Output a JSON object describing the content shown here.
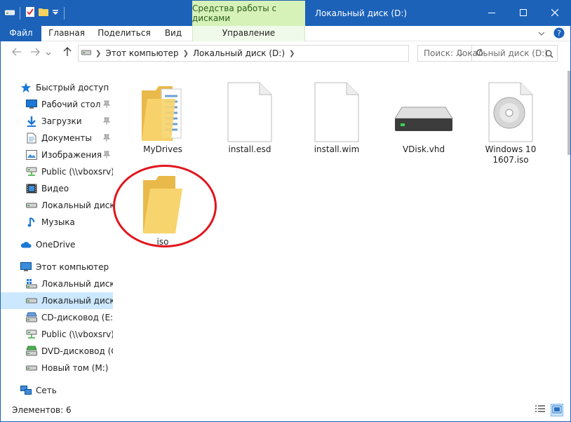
{
  "window": {
    "title": "Локальный диск (D:)",
    "context_group": "Средства работы с дисками"
  },
  "ribbon": {
    "tabs": [
      {
        "label": "Файл"
      },
      {
        "label": "Главная"
      },
      {
        "label": "Поделиться"
      },
      {
        "label": "Вид"
      },
      {
        "label": "Управление"
      }
    ]
  },
  "address": {
    "crumbs": [
      "Этот компьютер",
      "Локальный диск (D:)"
    ]
  },
  "search": {
    "placeholder": "Поиск: Локальный диск (D:)"
  },
  "sidebar": {
    "items": [
      {
        "label": "Быстрый доступ",
        "icon": "star-icon"
      },
      {
        "label": "Рабочий стол",
        "icon": "desktop-icon"
      },
      {
        "label": "Загрузки",
        "icon": "download-icon"
      },
      {
        "label": "Документы",
        "icon": "document-icon"
      },
      {
        "label": "Изображения",
        "icon": "pictures-icon"
      },
      {
        "label": "Public (\\\\vboxsrv) (",
        "icon": "network-drive-icon"
      },
      {
        "label": "Видео",
        "icon": "video-icon"
      },
      {
        "label": "Локальный диск (D",
        "icon": "drive-icon"
      },
      {
        "label": "Музыка",
        "icon": "music-icon"
      },
      {
        "label": "OneDrive",
        "icon": "cloud-icon"
      },
      {
        "label": "Этот компьютер",
        "icon": "computer-icon"
      },
      {
        "label": "Локальный диск (C",
        "icon": "system-drive-icon"
      },
      {
        "label": "Локальный диск (D",
        "icon": "drive-icon"
      },
      {
        "label": "CD-дисковод (E:) V",
        "icon": "cd-drive-icon"
      },
      {
        "label": "Public (\\\\vboxsrv) (",
        "icon": "network-drive-icon"
      },
      {
        "label": "DVD-дисковод (G:)",
        "icon": "dvd-drive-icon"
      },
      {
        "label": "Новый том (M:)",
        "icon": "drive-icon"
      },
      {
        "label": "Сеть",
        "icon": "network-icon"
      }
    ]
  },
  "files": [
    {
      "label": "MyDrives",
      "icon": "folder-with-docs-icon"
    },
    {
      "label": "install.esd",
      "icon": "file-icon"
    },
    {
      "label": "install.wim",
      "icon": "file-icon"
    },
    {
      "label": "VDisk.vhd",
      "icon": "vhd-drive-icon"
    },
    {
      "label": "Windows 10 1607.iso",
      "icon": "disc-image-icon"
    },
    {
      "label": "iso",
      "icon": "folder-icon"
    }
  ],
  "status": {
    "text": "Элементов: 6"
  },
  "colors": {
    "accent": "#1c62b9",
    "context_tab": "#d7f2b8",
    "selection": "#cce8ff",
    "highlight_circle": "#e0161e"
  }
}
